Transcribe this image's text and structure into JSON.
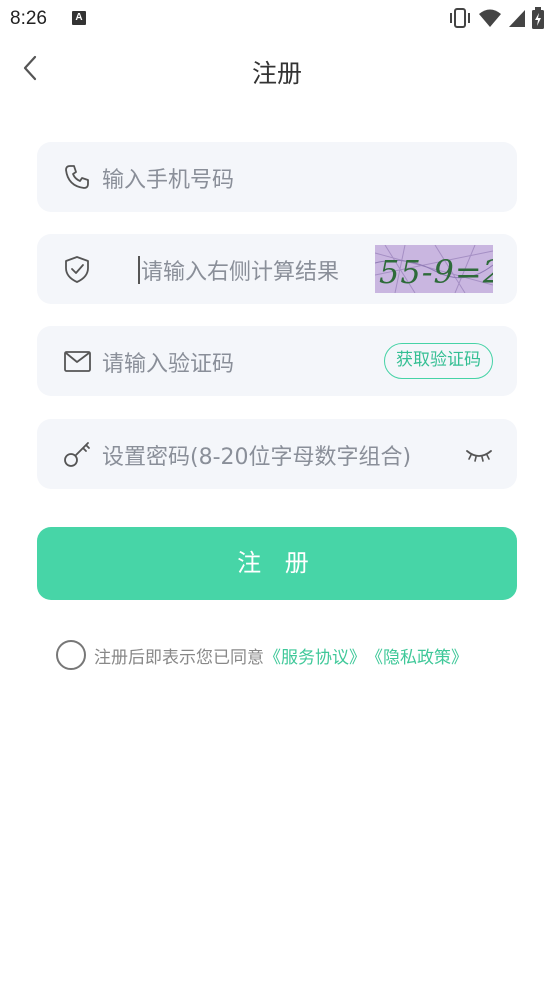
{
  "status": {
    "time": "8:26",
    "notif_icon": "A"
  },
  "nav": {
    "title": "注册"
  },
  "fields": {
    "phone_placeholder": "输入手机号码",
    "captcha_placeholder": "请输入右侧计算结果",
    "captcha_text": "55-9=2",
    "code_placeholder": "请输入验证码",
    "code_button": "获取验证码",
    "password_placeholder": "设置密码(8-20位字母数字组合)"
  },
  "submit_label": "注 册",
  "agreement": {
    "text": "注册后即表示您已同意",
    "service_link": "《服务协议》",
    "privacy_link": "《隐私政策》"
  },
  "colors": {
    "accent": "#47d5a7",
    "field_bg": "#f4f6fa"
  }
}
